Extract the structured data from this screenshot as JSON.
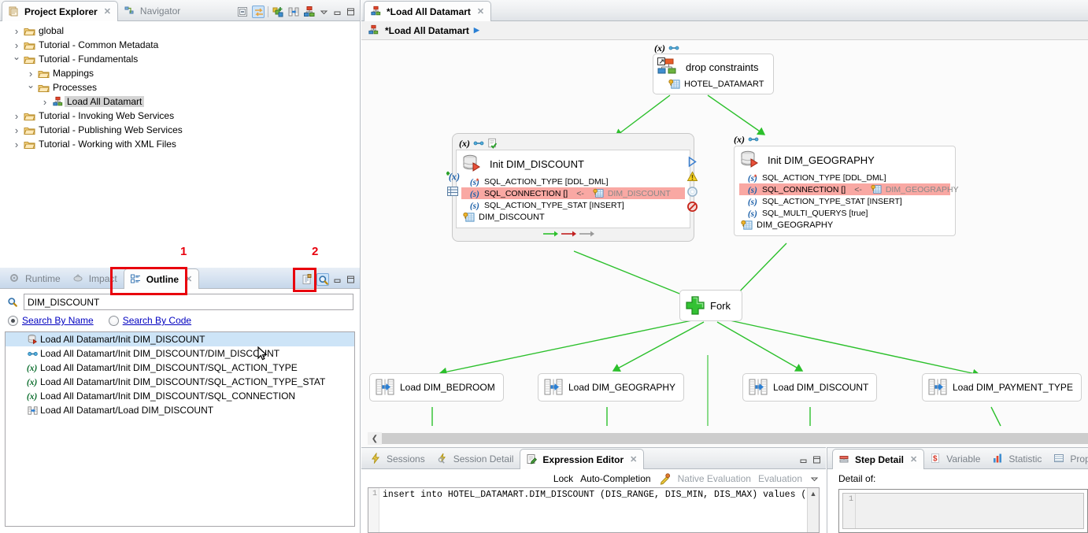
{
  "project_explorer": {
    "tabs": [
      {
        "label": "Project Explorer",
        "icon": "project-explorer-icon",
        "active": true,
        "close": "✕"
      },
      {
        "label": "Navigator",
        "icon": "navigator-icon",
        "active": false
      }
    ],
    "toolbar": [
      {
        "name": "collapse-all-icon"
      },
      {
        "name": "link-with-editor-icon"
      },
      {
        "name": "new-metadata-icon"
      },
      {
        "name": "new-mapping-icon"
      },
      {
        "name": "new-process-icon"
      },
      {
        "name": "view-menu-icon"
      },
      {
        "name": "minimize-icon"
      },
      {
        "name": "maximize-icon"
      }
    ],
    "tree": [
      {
        "label": "global",
        "indent": 1,
        "state": "closed",
        "icon": "folder-icon",
        "selected": false
      },
      {
        "label": "Tutorial - Common Metadata",
        "indent": 1,
        "state": "closed",
        "icon": "folder-icon",
        "selected": false
      },
      {
        "label": "Tutorial - Fundamentals",
        "indent": 1,
        "state": "open",
        "icon": "folder-icon",
        "selected": false
      },
      {
        "label": "Mappings",
        "indent": 2,
        "state": "closed",
        "icon": "folder-open-icon",
        "selected": false
      },
      {
        "label": "Processes",
        "indent": 2,
        "state": "open",
        "icon": "folder-open-icon",
        "selected": false
      },
      {
        "label": "Load All Datamart",
        "indent": 3,
        "state": "closed",
        "icon": "process-icon",
        "selected": true
      },
      {
        "label": "Tutorial - Invoking Web Services",
        "indent": 1,
        "state": "closed",
        "icon": "folder-icon",
        "selected": false
      },
      {
        "label": "Tutorial - Publishing Web Services",
        "indent": 1,
        "state": "closed",
        "icon": "folder-icon",
        "selected": false
      },
      {
        "label": "Tutorial - Working with XML Files",
        "indent": 1,
        "state": "closed",
        "icon": "folder-icon",
        "selected": false
      }
    ]
  },
  "outline_view": {
    "tabs": [
      {
        "label": "Runtime",
        "icon": "runtime-icon",
        "active": false
      },
      {
        "label": "Impact",
        "icon": "impact-icon",
        "active": false
      },
      {
        "label": "Outline",
        "icon": "outline-icon",
        "active": true,
        "close": "✕"
      }
    ],
    "toolbar": [
      {
        "name": "outline-list-icon"
      },
      {
        "name": "search-icon",
        "pressed": true
      },
      {
        "name": "minimize-icon"
      },
      {
        "name": "maximize-icon"
      }
    ],
    "search": {
      "icon": "search-icon",
      "value": "DIM_DISCOUNT",
      "placeholder": ""
    },
    "search_modes": [
      {
        "label": "Search By Name",
        "selected": true
      },
      {
        "label": "Search By Code",
        "selected": false
      }
    ],
    "results": [
      {
        "label": "Load All Datamart/Init DIM_DISCOUNT",
        "icon": "db-init-icon",
        "selected": true
      },
      {
        "label": "Load All Datamart/Init DIM_DISCOUNT/DIM_DISCOUNT",
        "icon": "link-icon",
        "selected": false
      },
      {
        "label": "Load All Datamart/Init DIM_DISCOUNT/SQL_ACTION_TYPE",
        "icon": "variable-icon",
        "selected": false
      },
      {
        "label": "Load All Datamart/Init DIM_DISCOUNT/SQL_ACTION_TYPE_STAT",
        "icon": "variable-icon",
        "selected": false
      },
      {
        "label": "Load All Datamart/Init DIM_DISCOUNT/SQL_CONNECTION",
        "icon": "variable-icon",
        "selected": false
      },
      {
        "label": "Load All Datamart/Load DIM_DISCOUNT",
        "icon": "load-icon",
        "selected": false
      }
    ]
  },
  "annotations": [
    {
      "number": "1",
      "target": "outline-tab"
    },
    {
      "number": "2",
      "target": "search-toolbar-button"
    }
  ],
  "editor": {
    "tabs": [
      {
        "label": "*Load All Datamart",
        "icon": "process-icon",
        "active": true,
        "close": "✕"
      }
    ],
    "breadcrumb": {
      "label": "*Load All Datamart",
      "icon": "process-icon",
      "chevron": "▶"
    },
    "nodes": {
      "drop_constraints": {
        "var_badge": "(x)",
        "link_badge": "link-icon",
        "title": "drop constraints",
        "icon": "mapping-icon",
        "table": "HOTEL_DATAMART",
        "table_icon": "table-key-icon"
      },
      "init_dim_discount": {
        "var_badge": "(x)",
        "link_badge": "link-icon",
        "check_badge": "validated-icon",
        "title": "Init DIM_DISCOUNT",
        "icon": "db-init-icon",
        "attributes": [
          {
            "name": "SQL_ACTION_TYPE [DDL_DML]",
            "icon": "sql-var-star-icon",
            "highlight": false
          },
          {
            "name": "SQL_CONNECTION []",
            "icon": "sql-var-icon",
            "highlight": true,
            "arrow": "<-",
            "source": "DIM_DISCOUNT",
            "source_icon": "table-key-icon"
          },
          {
            "name": "SQL_ACTION_TYPE_STAT [INSERT]",
            "icon": "sql-var-icon",
            "highlight": false
          }
        ],
        "table": "DIM_DISCOUNT",
        "table_icon": "table-key-icon",
        "left_buttons": [
          "add-variable-icon",
          "grid-icon"
        ],
        "right_buttons": [
          "run-icon",
          "warning-icon",
          "disabled-icon",
          "breakpoint-icon"
        ],
        "flow_legend": [
          "green-arrow",
          "red-arrow",
          "grey-arrow"
        ]
      },
      "init_dim_geography": {
        "var_badge": "(x)",
        "link_badge": "link-icon",
        "title": "Init DIM_GEOGRAPHY",
        "icon": "db-init-icon",
        "attributes": [
          {
            "name": "SQL_ACTION_TYPE [DDL_DML]",
            "icon": "sql-var-star-icon",
            "highlight": false
          },
          {
            "name": "SQL_CONNECTION []",
            "icon": "sql-var-icon",
            "highlight": true,
            "arrow": "<-",
            "source": "DIM_GEOGRAPHY",
            "source_icon": "table-key-icon"
          },
          {
            "name": "SQL_ACTION_TYPE_STAT [INSERT]",
            "icon": "sql-var-icon",
            "highlight": false
          },
          {
            "name": "SQL_MULTI_QUERYS [true]",
            "icon": "sql-var-icon",
            "highlight": false
          }
        ],
        "table": "DIM_GEOGRAPHY",
        "table_icon": "table-key-icon"
      },
      "fork": {
        "title": "Fork",
        "icon": "fork-icon"
      },
      "loads": [
        {
          "title": "Load DIM_BEDROOM",
          "icon": "load-icon"
        },
        {
          "title": "Load DIM_GEOGRAPHY",
          "icon": "load-icon"
        },
        {
          "title": "Load DIM_DISCOUNT",
          "icon": "load-icon"
        },
        {
          "title": "Load DIM_PAYMENT_TYPE",
          "icon": "load-icon"
        }
      ]
    },
    "scrollbar": {
      "left_arrow": "❮"
    }
  },
  "expression_editor": {
    "tabs": [
      {
        "label": "Sessions",
        "icon": "sessions-icon",
        "active": false
      },
      {
        "label": "Session Detail",
        "icon": "session-detail-icon",
        "active": false
      },
      {
        "label": "Expression Editor",
        "icon": "expression-editor-icon",
        "active": true,
        "close": "✕"
      }
    ],
    "toolbar": [
      {
        "label": "Lock",
        "type": "text"
      },
      {
        "label": "Auto-Completion",
        "type": "text"
      },
      {
        "label": "Native Evaluation",
        "type": "text",
        "icon": "native-eval-icon",
        "disabled": true
      },
      {
        "label": "Evaluation",
        "type": "text",
        "disabled": true
      }
    ],
    "view_menu_icon": "view-menu-icon",
    "minimize_icon": "minimize-icon",
    "maximize_icon": "maximize-icon",
    "code": {
      "line_number": "1",
      "text": "insert into HOTEL_DATAMART.DIM_DISCOUNT (DIS_RANGE, DIS_MIN, DIS_MAX) values ("
    }
  },
  "step_detail": {
    "tabs": [
      {
        "label": "Step Detail",
        "icon": "step-detail-icon",
        "active": true,
        "close": "✕"
      },
      {
        "label": "Variable",
        "icon": "variable-dollar-icon",
        "active": false
      },
      {
        "label": "Statistic",
        "icon": "statistic-icon",
        "active": false
      },
      {
        "label": "Propert",
        "icon": "properties-icon",
        "active": false
      }
    ],
    "detail_of_label": "Detail of:",
    "detail_value": "",
    "line_number": "1"
  },
  "colors": {
    "accent_green": "#2cc02c",
    "highlight_row": "#f9a8a3",
    "selection_blue": "#cde4f7",
    "annotation_red": "#e8000d",
    "link_blue": "#0000c0"
  }
}
